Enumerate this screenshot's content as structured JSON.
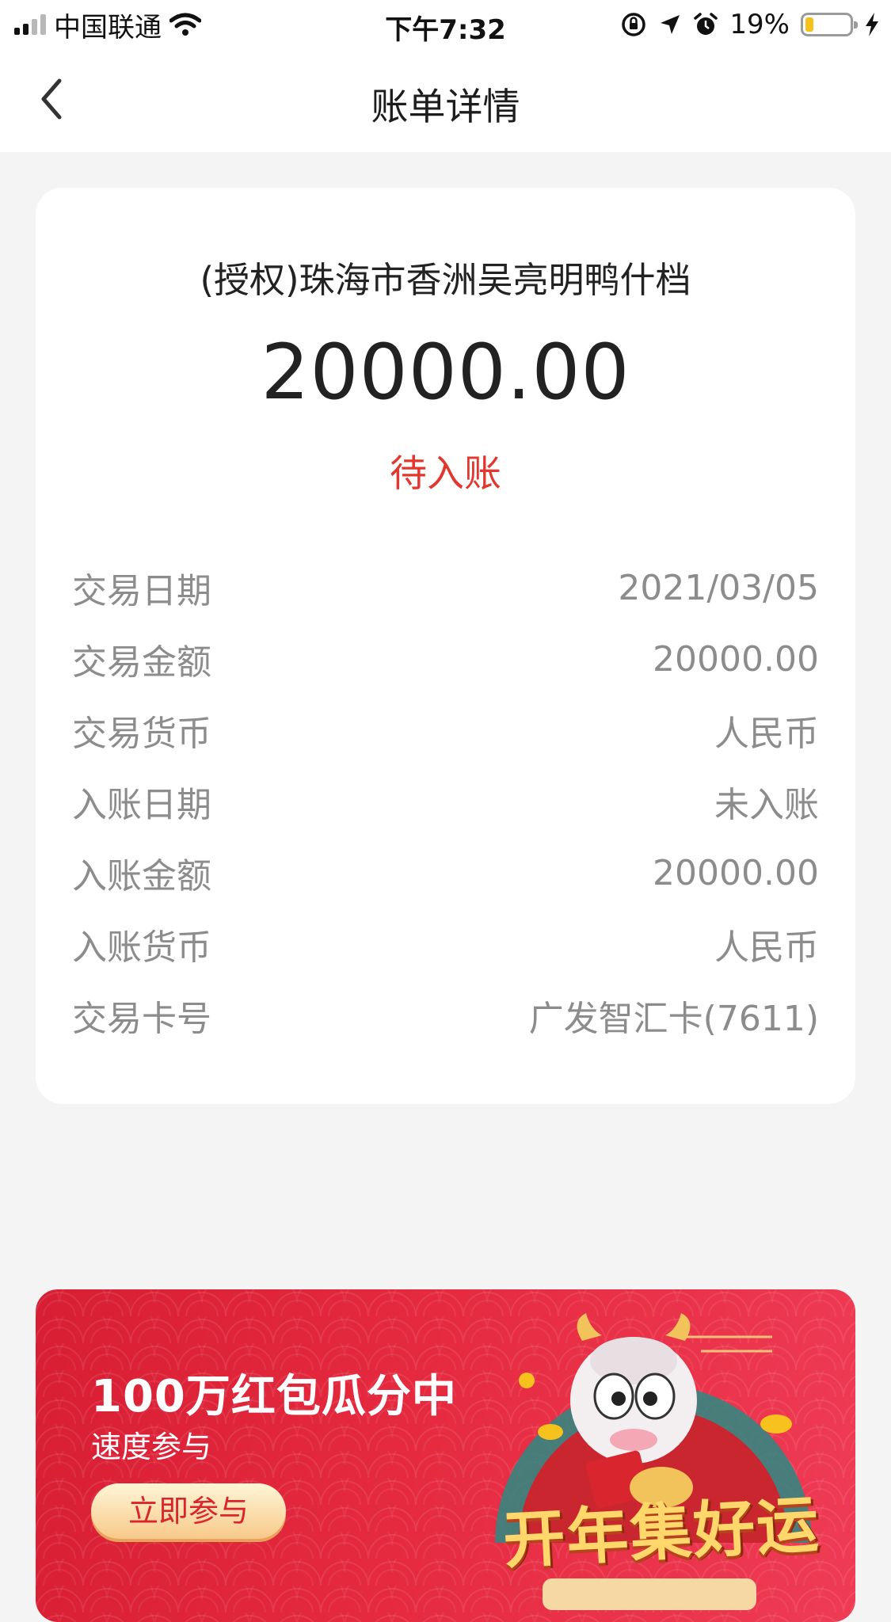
{
  "status_bar": {
    "carrier": "中国联通",
    "time": "下午7:32",
    "battery_percent": "19%",
    "battery_level": 0.19,
    "battery_color": "#f3c21b"
  },
  "nav": {
    "title": "账单详情",
    "back_icon": "chevron-left-icon"
  },
  "bill": {
    "merchant": "(授权)珠海市香洲吴亮明鸭什档",
    "amount": "20000.00",
    "status": "待入账",
    "status_color": "#e2372f",
    "rows": [
      {
        "label": "交易日期",
        "value": "2021/03/05"
      },
      {
        "label": "交易金额",
        "value": "20000.00"
      },
      {
        "label": "交易货币",
        "value": "人民币"
      },
      {
        "label": "入账日期",
        "value": "未入账"
      },
      {
        "label": "入账金额",
        "value": "20000.00"
      },
      {
        "label": "入账货币",
        "value": "人民币"
      },
      {
        "label": "交易卡号",
        "value": "广发智汇卡(7611)"
      }
    ]
  },
  "banner": {
    "title": "100万红包瓜分中",
    "subtitle": "速度参与",
    "button_label": "立即参与",
    "slogan": "开年集好运",
    "background_color": "#e52a3f"
  }
}
